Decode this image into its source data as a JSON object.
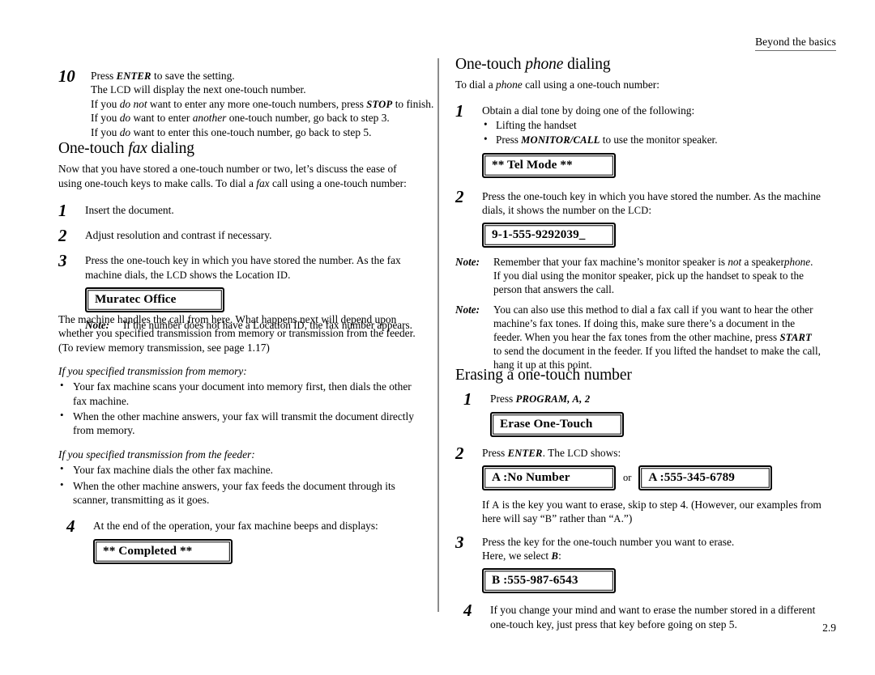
{
  "header": {
    "running_head": "Beyond the basics"
  },
  "folio": {
    "page_number": "2.9"
  },
  "left_column": {
    "step10": {
      "number": "10",
      "line1_pre": "Press ",
      "line1_key": "ENTER",
      "line1_post": " to save the setting.",
      "line2_pre": "The ",
      "line2_sc": "LCD",
      "line2_post": " will display the next one-touch number.",
      "line3_pre": "If you ",
      "line3_it": "do not",
      "line3_mid": " want to enter any more one-touch numbers, press ",
      "line3_key": "STOP",
      "line3_post": " to finish.",
      "line4_pre": "If you ",
      "line4_it": "do",
      "line4_mid": " want to enter ",
      "line4_it2": "another",
      "line4_post": " one-touch number, go back to step 3.",
      "line5_pre": "If you ",
      "line5_it": "do",
      "line5_post": " want to enter this one-touch number, go back to step 5."
    },
    "fax_section": {
      "heading_pre": "One-touch ",
      "heading_it": "fax",
      "heading_post": " dialing",
      "intro_pre": "Now that you have stored a one-touch number or two, let’s discuss the ease of using one-touch keys to make calls. To dial a ",
      "intro_it": "fax",
      "intro_post": " call using a one-touch number:",
      "steps": [
        {
          "number": "1",
          "text": "Insert the document."
        },
        {
          "number": "2",
          "text": "Adjust resolution and contrast if necessary."
        }
      ],
      "step3": {
        "number": "3",
        "text_pre": "Press the one-touch key in which you have stored the number. As the fax machine dials, the ",
        "text_sc1": "LCD",
        "text_mid": " shows the Location ",
        "text_sc2": "ID",
        "text_post": ".",
        "lcd": "Muratec Office",
        "note_label": "Note:",
        "note_pre": "If the number does not have a Location ",
        "note_sc": "ID",
        "note_post": ", the fax number appears."
      },
      "para1_line1": "The machine handles the call from here. What happens next will depend upon",
      "para1_line2": "whether you specified transmission from memory or transmission from the feeder.",
      "para1_line3": "(To review memory transmission, see page 1.17)",
      "memory_subhead": "If you specified transmission from memory:",
      "memory_bullets": [
        "Your fax machine scans your document into memory first, then dials the other fax machine.",
        "When the other machine answers, your fax will transmit the document directly from memory."
      ],
      "feeder_subhead": "If you specified transmission from the feeder:",
      "feeder_bullets": [
        "Your fax machine dials the other fax machine.",
        "When the other machine answers, your fax feeds the document through its scanner, transmitting as it goes."
      ],
      "step4": {
        "number": "4",
        "text": "At the end of the operation, your fax machine beeps and displays:",
        "lcd": "** Completed **"
      }
    }
  },
  "right_column": {
    "phone_section": {
      "heading_pre": "One-touch ",
      "heading_it": "phone",
      "heading_post": " dialing",
      "intro_pre": "To dial a ",
      "intro_it": "phone",
      "intro_post": " call using a one-touch number:",
      "step1": {
        "number": "1",
        "text": "Obtain a dial tone by doing one of the following:",
        "bullet1": "Lifting the handset",
        "bullet2_pre": "Press ",
        "bullet2_key": "MONITOR/CALL",
        "bullet2_post": " to use the monitor speaker.",
        "lcd": "**  Tel Mode  **"
      },
      "step2": {
        "number": "2",
        "text_pre": "Press the one-touch key in which you have stored the number. As the machine dials, it shows the number on the ",
        "text_sc": "LCD",
        "text_post": ":",
        "lcd": "9-1-555-9292039_"
      },
      "note1": {
        "label": "Note:",
        "pre": "Remember that your fax machine’s monitor speaker is ",
        "it1": "not",
        "mid": " a speaker",
        "it2": "phone",
        "post": ". If you dial using the monitor speaker, pick up the handset to speak to the person that answers the call."
      },
      "note2": {
        "label": "Note:",
        "pre": "You can also use this method to dial a fax call if you want to hear the other machine’s fax tones. If doing this, make sure there’s a document in the feeder. When you hear the fax tones from the other machine, press ",
        "key": "START",
        "post": " to send the document in the feeder. If you lifted the handset to make the call, hang it up at this point."
      }
    },
    "erase_section": {
      "heading": "Erasing a one-touch number",
      "step1": {
        "number": "1",
        "text_pre": "Press ",
        "text_key": "PROGRAM, A, 2",
        "lcd": "Erase One-Touch"
      },
      "step2": {
        "number": "2",
        "text_pre": "Press ",
        "text_key": "ENTER",
        "text_mid": ". The ",
        "text_sc": "LCD",
        "text_post": " shows:",
        "lcd_a": "A :No Number",
        "or_label": "or",
        "lcd_b": "A :555-345-6789",
        "after_pre": "If ",
        "after_sc1": "A",
        "after_mid": " is the key you want to erase, skip to step 4. (However, our examples from here will say “",
        "after_sc2": "B",
        "after_mid2": "” rather than “",
        "after_sc3": "A",
        "after_post": ".”)"
      },
      "step3": {
        "number": "3",
        "line1": "Press the key for the one-touch number you want to erase.",
        "line2_pre": "Here, we select ",
        "line2_sc": "B",
        "line2_post": ":",
        "lcd": "B :555-987-6543"
      },
      "step4": {
        "number": "4",
        "text": "If you change your mind and want to erase the number stored in a different one-touch key, just press that key before going on step 5."
      }
    }
  }
}
